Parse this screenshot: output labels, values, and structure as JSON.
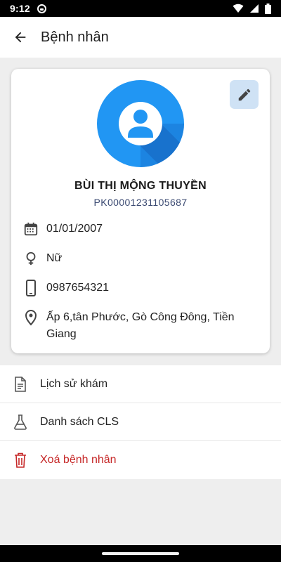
{
  "status_bar": {
    "time": "9:12",
    "icons": [
      "notification-dot-icon",
      "wifi-icon",
      "signal-icon",
      "battery-icon"
    ]
  },
  "app_bar": {
    "back_icon": "arrow-left-icon",
    "title": "Bệnh nhân"
  },
  "patient": {
    "name": "BÙI THỊ MỘNG THUYỀN",
    "code": "PK00001231105687",
    "edit_icon": "pencil-icon",
    "avatar_icon": "person-icon",
    "details": [
      {
        "icon": "calendar-icon",
        "text": "01/01/2007"
      },
      {
        "icon": "female-icon",
        "text": "Nữ"
      },
      {
        "icon": "phone-icon",
        "text": "0987654321"
      },
      {
        "icon": "location-pin-icon",
        "text": "Ấp 6,tân Phước, Gò Công Đông, Tiền Giang"
      }
    ]
  },
  "menu": [
    {
      "icon": "document-icon",
      "label": "Lịch sử khám"
    },
    {
      "icon": "flask-icon",
      "label": "Danh sách CLS"
    },
    {
      "icon": "trash-icon",
      "label": "Xoá bệnh nhân"
    }
  ],
  "colors": {
    "primary": "#2196F3",
    "edit_button_bg": "#CFE2F5",
    "danger": "#C62828",
    "code_text": "#3B4A72",
    "background": "#EEEEEE"
  }
}
